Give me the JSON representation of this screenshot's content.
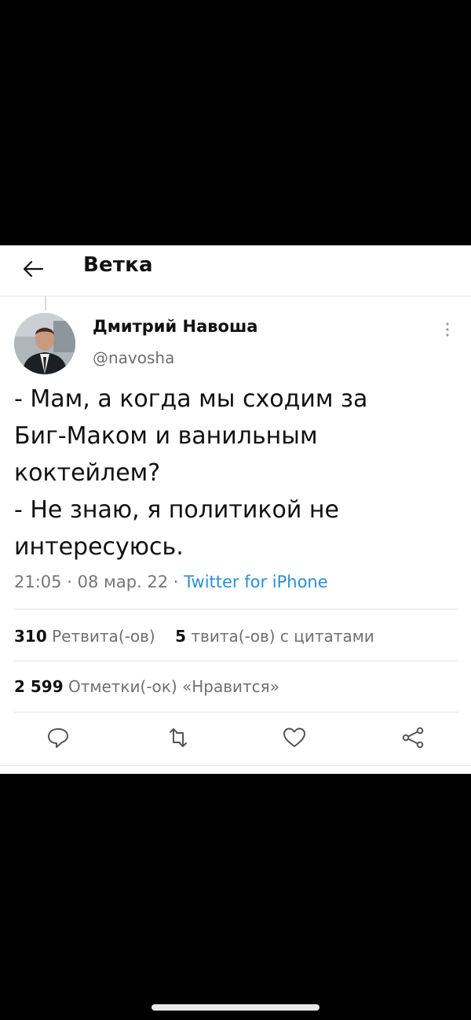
{
  "header": {
    "title": "Ветка"
  },
  "author": {
    "name": "Дмитрий Навоша",
    "handle": "@navosha"
  },
  "tweet": {
    "text": "- Мам, а когда мы сходим за\nБиг-Маком и ванильным\nкоктейлем?\n- Не знаю, я политикой не\nинтересуюсь.",
    "time": "21:05",
    "date": "08 мар. 22",
    "separator": "·",
    "client": "Twitter for iPhone"
  },
  "stats": {
    "retweets_count": "310",
    "retweets_label": "Ретвита(-ов)",
    "quotes_count": "5",
    "quotes_label": "твита(-ов) с цитатами",
    "likes_count": "2 599",
    "likes_label": "Отметки(-ок) «Нравится»"
  },
  "icons": {
    "back": "arrow-left-icon",
    "more": "more-vertical-icon",
    "reply": "reply-icon",
    "retweet": "retweet-icon",
    "like": "heart-icon",
    "share": "share-icon"
  },
  "colors": {
    "link": "#2b8fd6",
    "text": "#111111",
    "muted": "#6f6f6f",
    "background": "#000000"
  }
}
